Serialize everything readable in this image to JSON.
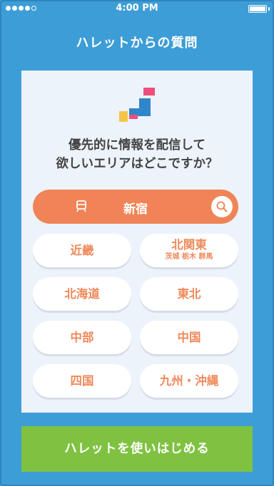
{
  "status_bar": {
    "time": "4:00 PM",
    "signal_dots_filled": 4,
    "signal_dots_total": 5,
    "battery_level": 1.0
  },
  "header": {
    "title": "ハレットからの質問"
  },
  "card": {
    "logo_icon": "hallet-logo-icon",
    "question_line1": "優先的に情報を配信して",
    "question_line2": "欲しいエリアはどこですか？",
    "search": {
      "label": "新宿",
      "station_icon": "train-station-icon",
      "search_icon": "search-icon"
    },
    "regions": [
      {
        "name": "近畿",
        "sub": ""
      },
      {
        "name": "北関東",
        "sub": "茨城 栃木 群馬"
      },
      {
        "name": "北海道",
        "sub": ""
      },
      {
        "name": "東北",
        "sub": ""
      },
      {
        "name": "中部",
        "sub": ""
      },
      {
        "name": "中国",
        "sub": ""
      },
      {
        "name": "四国",
        "sub": ""
      },
      {
        "name": "九州・沖縄",
        "sub": ""
      }
    ]
  },
  "footer": {
    "start_button": "ハレットを使いはじめる"
  },
  "colors": {
    "background": "#3d9dd6",
    "card": "#edf3fa",
    "accent_orange": "#f08456",
    "region_text": "#ef8a5c",
    "start_green": "#7fc242"
  }
}
